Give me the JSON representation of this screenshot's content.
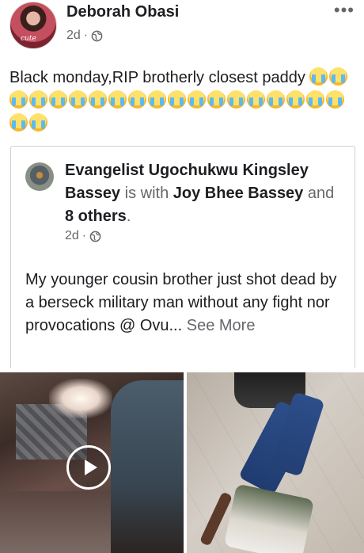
{
  "post": {
    "author": "Deborah Obasi",
    "time": "2d",
    "avatar_tag": "cute",
    "text": "Black monday,RIP brotherly closest paddy",
    "emoji_count": 21,
    "emoji_name": "loudly-crying-face"
  },
  "shared": {
    "author": "Evangelist Ugochukwu Kingsley Bassey",
    "is_with": "is with",
    "tagged": "Joy Bhee Bassey",
    "and": "and",
    "others": "8 others",
    "time": "2d",
    "text": "My younger cousin brother just shot dead by a berseck military man without any fight nor provocations @ Ovu...",
    "see_more": "See More"
  },
  "icons": {
    "globe": "globe-icon",
    "more": "more-options-icon",
    "play": "play-icon"
  }
}
